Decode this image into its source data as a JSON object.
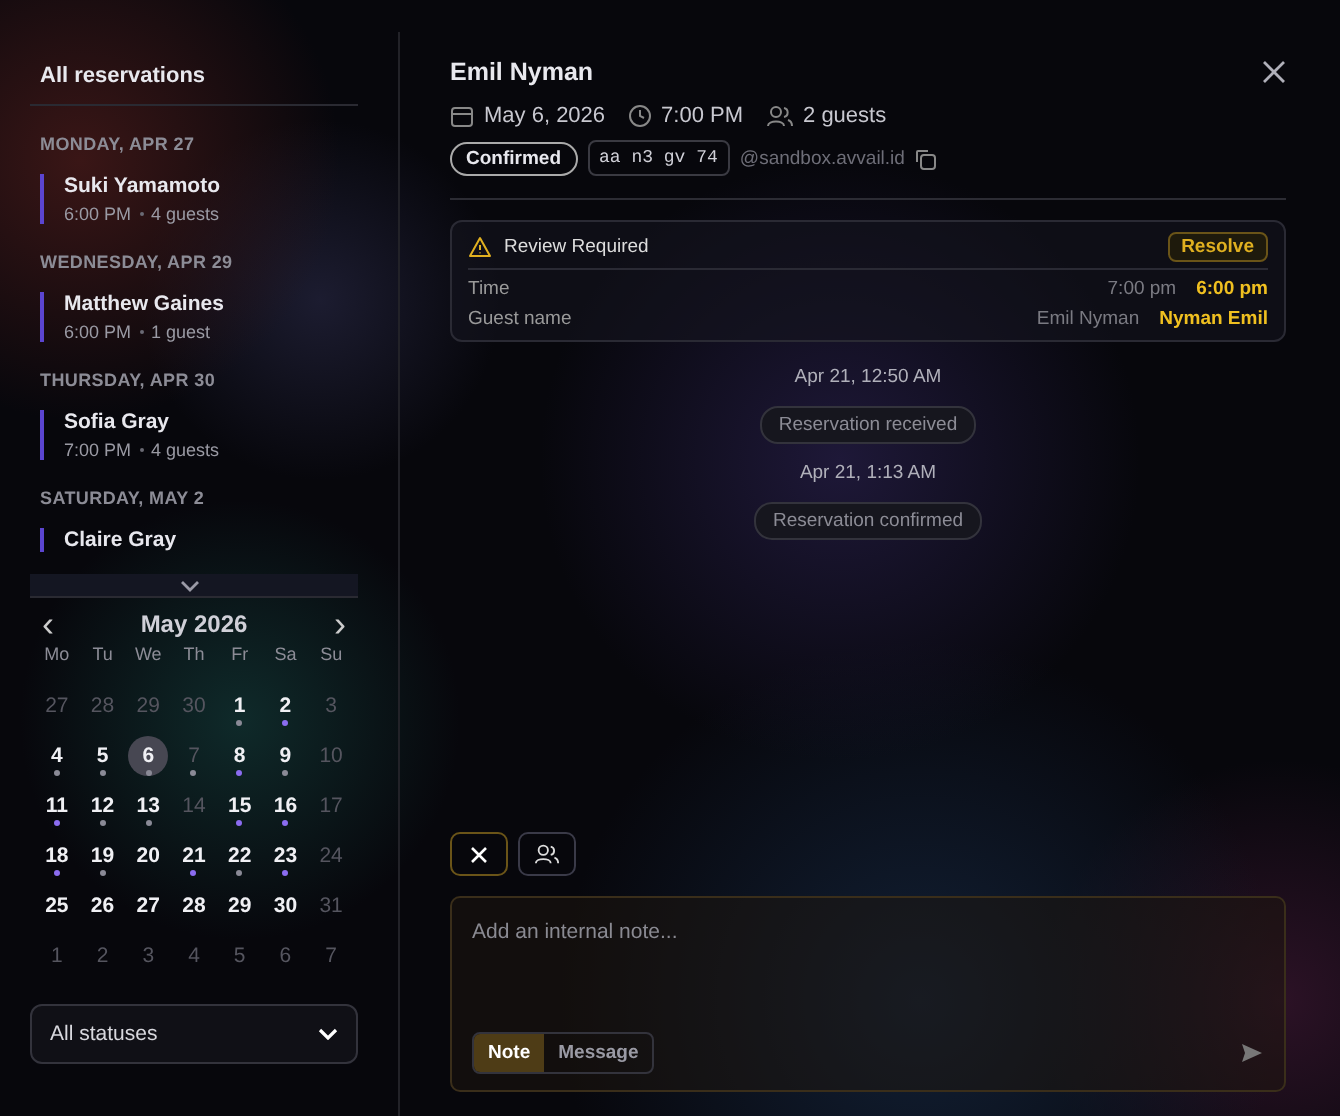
{
  "sidebar": {
    "title": "All reservations",
    "groups": [
      {
        "date": "MONDAY, APR 27",
        "items": [
          {
            "name": "Suki Yamamoto",
            "time": "6:00 PM",
            "guests": "4 guests"
          }
        ]
      },
      {
        "date": "WEDNESDAY, APR 29",
        "items": [
          {
            "name": "Matthew Gaines",
            "time": "6:00 PM",
            "guests": "1 guest"
          }
        ]
      },
      {
        "date": "THURSDAY, APR 30",
        "items": [
          {
            "name": "Sofia Gray",
            "time": "7:00 PM",
            "guests": "4 guests"
          }
        ]
      },
      {
        "date": "SATURDAY, MAY 2",
        "items": [
          {
            "name": "Claire Gray"
          }
        ]
      }
    ]
  },
  "calendar": {
    "prev": "‹",
    "next": "›",
    "month": "May 2026",
    "weekdays": [
      "Mo",
      "Tu",
      "We",
      "Th",
      "Fr",
      "Sa",
      "Su"
    ],
    "days": [
      {
        "day": "27",
        "muted": true,
        "selected": false
      },
      {
        "day": "28",
        "muted": true,
        "selected": false
      },
      {
        "day": "29",
        "muted": true,
        "selected": false
      },
      {
        "day": "30",
        "muted": true,
        "selected": false
      },
      {
        "day": "1",
        "muted": false,
        "selected": false,
        "color": "#8a8a96"
      },
      {
        "day": "2",
        "muted": false,
        "selected": false,
        "color": "#8b6cf0"
      },
      {
        "day": "3",
        "muted": true,
        "selected": false
      },
      {
        "day": "4",
        "muted": false,
        "selected": false,
        "color": "#8a8a96"
      },
      {
        "day": "5",
        "muted": false,
        "selected": false,
        "color": "#8a8a96"
      },
      {
        "day": "6",
        "muted": false,
        "selected": true,
        "color": "#8a8a96"
      },
      {
        "day": "7",
        "muted": true,
        "selected": false,
        "color": "#8a8a96"
      },
      {
        "day": "8",
        "muted": false,
        "selected": false,
        "color": "#8b6cf0"
      },
      {
        "day": "9",
        "muted": false,
        "selected": false,
        "color": "#8a8a96"
      },
      {
        "day": "10",
        "muted": true,
        "selected": false
      },
      {
        "day": "11",
        "muted": false,
        "selected": false,
        "color": "#8b6cf0"
      },
      {
        "day": "12",
        "muted": false,
        "selected": false,
        "color": "#8a8a96"
      },
      {
        "day": "13",
        "muted": false,
        "selected": false,
        "color": "#8a8a96"
      },
      {
        "day": "14",
        "muted": true,
        "selected": false
      },
      {
        "day": "15",
        "muted": false,
        "selected": false,
        "color": "#8b6cf0"
      },
      {
        "day": "16",
        "muted": false,
        "selected": false,
        "color": "#8b6cf0"
      },
      {
        "day": "17",
        "muted": true,
        "selected": false
      },
      {
        "day": "18",
        "muted": false,
        "selected": false,
        "color": "#8b6cf0"
      },
      {
        "day": "19",
        "muted": false,
        "selected": false,
        "color": "#8a8a96"
      },
      {
        "day": "20",
        "muted": false,
        "selected": false
      },
      {
        "day": "21",
        "muted": false,
        "selected": false,
        "color": "#8b6cf0"
      },
      {
        "day": "22",
        "muted": false,
        "selected": false,
        "color": "#8a8a96"
      },
      {
        "day": "23",
        "muted": false,
        "selected": false,
        "color": "#8b6cf0"
      },
      {
        "day": "24",
        "muted": true,
        "selected": false
      },
      {
        "day": "25",
        "muted": false,
        "selected": false
      },
      {
        "day": "26",
        "muted": false,
        "selected": false
      },
      {
        "day": "27",
        "muted": false,
        "selected": false
      },
      {
        "day": "28",
        "muted": false,
        "selected": false
      },
      {
        "day": "29",
        "muted": false,
        "selected": false
      },
      {
        "day": "30",
        "muted": false,
        "selected": false
      },
      {
        "day": "31",
        "muted": true,
        "selected": false
      },
      {
        "day": "1",
        "muted": true,
        "selected": false
      },
      {
        "day": "2",
        "muted": true,
        "selected": false
      },
      {
        "day": "3",
        "muted": true,
        "selected": false
      },
      {
        "day": "4",
        "muted": true,
        "selected": false
      },
      {
        "day": "5",
        "muted": true,
        "selected": false
      },
      {
        "day": "6",
        "muted": true,
        "selected": false
      },
      {
        "day": "7",
        "muted": true,
        "selected": false
      }
    ]
  },
  "status_filter": {
    "value": "All statuses"
  },
  "detail": {
    "name": "Emil Nyman",
    "date": "May 6, 2026",
    "time": "7:00 PM",
    "guests": "2 guests",
    "status": "Confirmed",
    "code": "aa n3 gv 74",
    "email": "@sandbox.avvail.id",
    "review": {
      "title": "Review Required",
      "action": "Resolve",
      "rows": [
        {
          "label": "Time",
          "old": "7:00 pm",
          "new": "6:00 pm"
        },
        {
          "label": "Guest name",
          "old": "Emil Nyman",
          "new": "Nyman Emil"
        }
      ]
    },
    "timeline": [
      {
        "time": "Apr 21, 12:50 AM",
        "event": "Reservation received"
      },
      {
        "time": "Apr 21, 1:13 AM",
        "event": "Reservation confirmed"
      }
    ],
    "composer": {
      "placeholder": "Add an internal note...",
      "tabs": [
        {
          "label": "Note",
          "selected": true
        },
        {
          "label": "Message",
          "selected": false
        }
      ]
    }
  }
}
